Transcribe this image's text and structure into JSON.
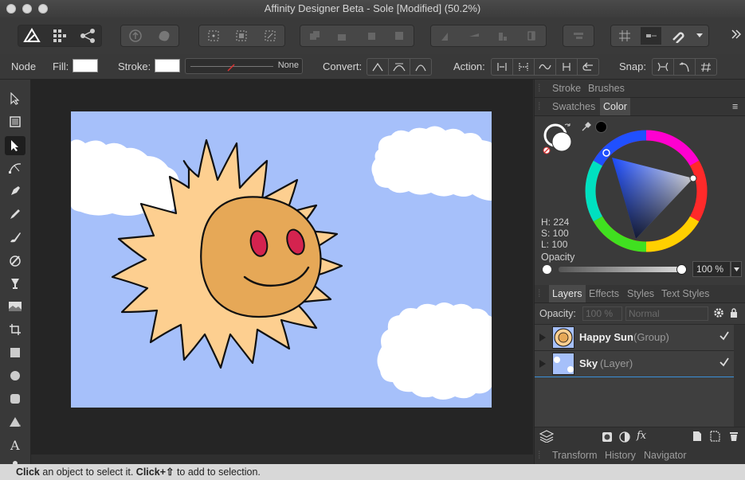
{
  "window": {
    "title": "Affinity Designer Beta - Sole [Modified] (50.2%)"
  },
  "context_bar": {
    "tool_name": "Node",
    "fill_label": "Fill:",
    "stroke_label": "Stroke:",
    "stroke_width_value": "None",
    "convert_label": "Convert:",
    "action_label": "Action:",
    "snap_label": "Snap:"
  },
  "panels": {
    "top_tabs": [
      "Stroke",
      "Brushes"
    ],
    "color_tabs": [
      "Swatches",
      "Color"
    ],
    "hsl": {
      "h": "H: 224",
      "s": "S: 100",
      "l": "L: 100"
    },
    "opacity_label": "Opacity",
    "opacity_value": "100 %",
    "layer_tabs": [
      "Layers",
      "Effects",
      "Styles",
      "Text Styles"
    ],
    "layer_opacity_label": "Opacity:",
    "layer_opacity_value": "100 %",
    "blend_mode": "Normal",
    "layers": [
      {
        "name": "Happy Sun",
        "type": "(Group)"
      },
      {
        "name": "Sky",
        "type": "(Layer)"
      }
    ],
    "bottom_tabs": [
      "Transform",
      "History",
      "Navigator"
    ],
    "fx_label": "fx"
  },
  "status": {
    "click1": "Click",
    "text1": " an object to select it. ",
    "click2": "Click",
    "plus_shift": "+⇧",
    "text2": " to add to selection."
  },
  "colors": {
    "sky": "#a6c0fa",
    "sun_rays": "#fdcf90",
    "sun_face": "#e6a857",
    "eyes": "#d4234f"
  }
}
